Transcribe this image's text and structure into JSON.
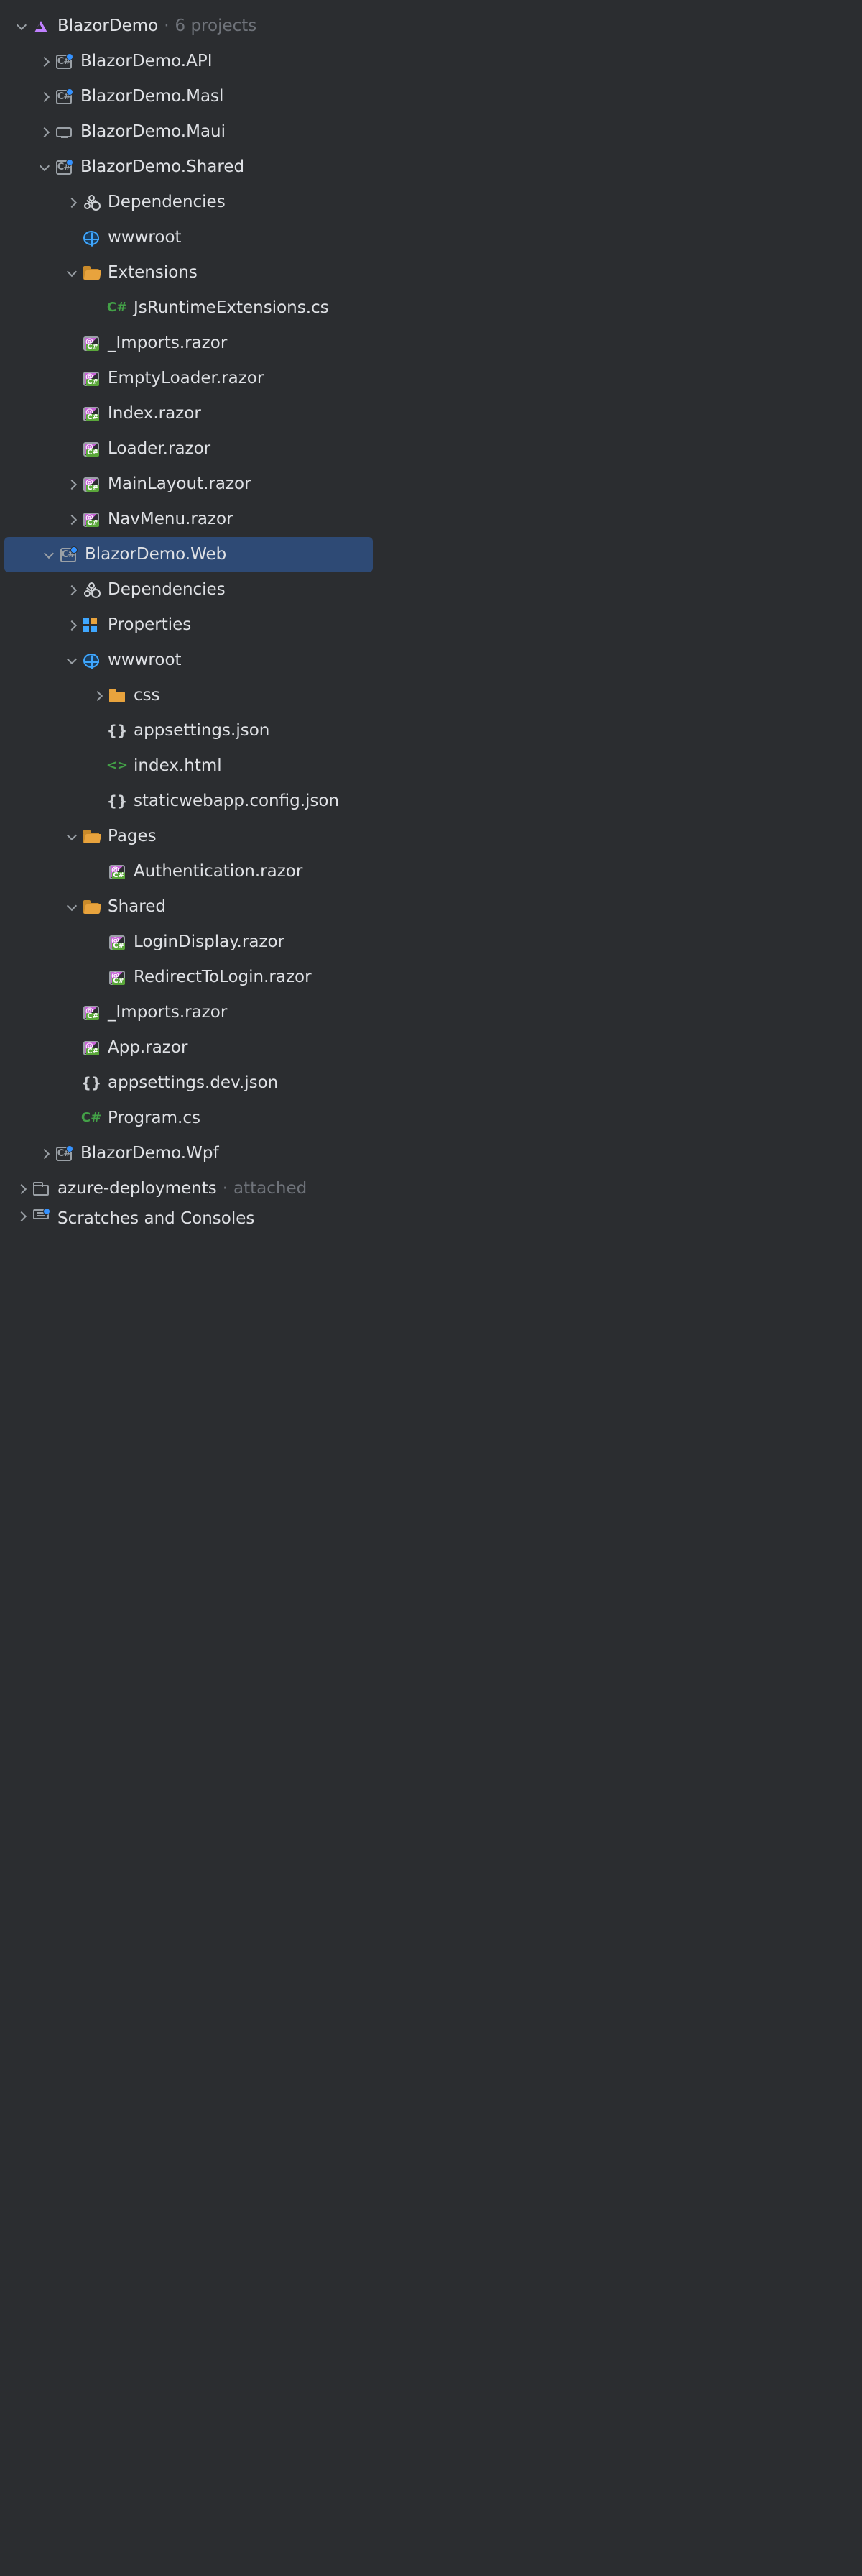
{
  "solution": {
    "name": "BlazorDemo",
    "suffix": "6 projects"
  },
  "projects": {
    "api": "BlazorDemo.API",
    "masl": "BlazorDemo.Masl",
    "maui": "BlazorDemo.Maui",
    "shared": "BlazorDemo.Shared",
    "web": "BlazorDemo.Web",
    "wpf": "BlazorDemo.Wpf"
  },
  "shared": {
    "deps": "Dependencies",
    "wwwroot": "wwwroot",
    "extensions": {
      "folder": "Extensions",
      "jsruntime": "JsRuntimeExtensions.cs"
    },
    "files": {
      "imports": "_Imports.razor",
      "emptyloader": "EmptyLoader.razor",
      "index": "Index.razor",
      "loader": "Loader.razor",
      "mainlayout": "MainLayout.razor",
      "navmenu": "NavMenu.razor"
    }
  },
  "web": {
    "deps": "Dependencies",
    "props": "Properties",
    "wwwroot": {
      "folder": "wwwroot",
      "css": "css",
      "appsettings": "appsettings.json",
      "index": "index.html",
      "swa": "staticwebapp.config.json"
    },
    "pages": {
      "folder": "Pages",
      "auth": "Authentication.razor"
    },
    "sharedf": {
      "folder": "Shared",
      "login": "LoginDisplay.razor",
      "redirect": "RedirectToLogin.razor"
    },
    "files": {
      "imports": "_Imports.razor",
      "app": "App.razor",
      "appsettingsdev": "appsettings.dev.json",
      "program": "Program.cs"
    }
  },
  "azure": {
    "name": "azure-deployments",
    "suffix": "attached"
  },
  "scratches": "Scratches and Consoles"
}
